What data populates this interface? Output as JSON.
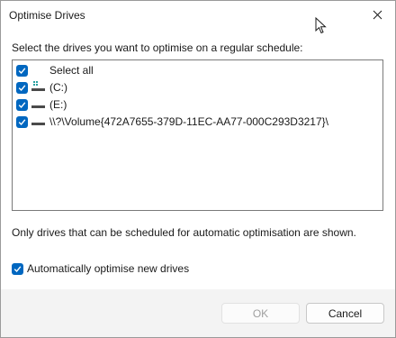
{
  "window": {
    "title": "Optimise Drives"
  },
  "dialog": {
    "instruction": "Select the drives you want to optimise on a regular schedule:",
    "drives": [
      {
        "label": "Select all",
        "checked": true,
        "icon": "none"
      },
      {
        "label": "(C:)",
        "checked": true,
        "icon": "system-drive-icon"
      },
      {
        "label": "(E:)",
        "checked": true,
        "icon": "drive-icon"
      },
      {
        "label": "\\\\?\\Volume{472A7655-379D-11EC-AA77-000C293D3217}\\",
        "checked": true,
        "icon": "drive-icon"
      }
    ],
    "note": "Only drives that can be scheduled for automatic optimisation are shown.",
    "auto_optimise": {
      "label": "Automatically optimise new drives",
      "checked": true
    }
  },
  "footer": {
    "ok_label": "OK",
    "cancel_label": "Cancel"
  },
  "colors": {
    "accent": "#0067c0",
    "disabled_text": "#a0a0a0"
  }
}
